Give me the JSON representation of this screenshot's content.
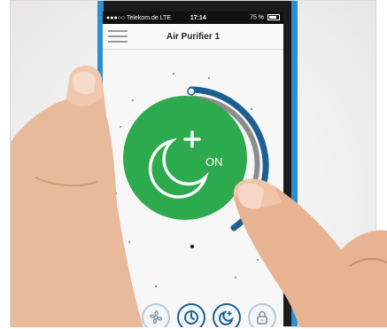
{
  "status_bar": {
    "carrier": "●●●○○ Telekom.de  LTE",
    "time": "17:14",
    "battery": "75 %"
  },
  "nav": {
    "title": "Air Purifier 1"
  },
  "mode_button": {
    "icon": "moon-plus-icon",
    "label": "ON"
  },
  "toolbar": {
    "items": [
      {
        "icon": "fan-icon"
      },
      {
        "icon": "clock-icon"
      },
      {
        "icon": "night-mode-icon"
      },
      {
        "icon": "lock-icon"
      }
    ]
  },
  "colors": {
    "accent_green": "#2daa4e",
    "ring_blue": "#1e5f92",
    "ring_gray": "#8d8d8d",
    "phone_frame": "#2b8fd0"
  }
}
